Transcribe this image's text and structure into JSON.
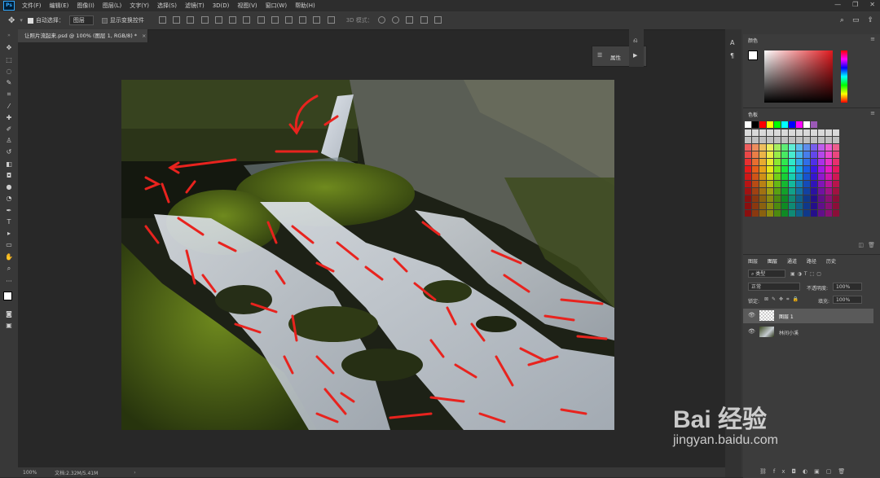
{
  "menu": [
    "文件(F)",
    "编辑(E)",
    "图像(I)",
    "图层(L)",
    "文字(Y)",
    "选择(S)",
    "滤镜(T)",
    "3D(D)",
    "视图(V)",
    "窗口(W)",
    "帮助(H)"
  ],
  "app_logo": "Ps",
  "options": {
    "auto_select_label": "自动选择：",
    "auto_select_value": "图层",
    "show_transform_label": "显示变换控件",
    "mode_3d_label": "3D 模式："
  },
  "document": {
    "tab_title": "让照片流起来.psd @ 100% (图层 1, RGB/8) *",
    "close": "×"
  },
  "status": {
    "zoom": "100%",
    "doc_info": "文档:2.32M/5.41M"
  },
  "properties_label": "属性",
  "panels": {
    "color_tab": "颜色",
    "swatches_tab": "色板",
    "layers_tabs": [
      "图层",
      "通道",
      "路径",
      "历史"
    ],
    "kind_label": "类型",
    "blend_mode": "正常",
    "opacity_label": "不透明度:",
    "opacity_value": "100%",
    "lock_label": "锁定:",
    "fill_label": "填充:",
    "fill_value": "100%",
    "layers": [
      {
        "name": "图层 1"
      },
      {
        "name": "林间小溪"
      }
    ]
  },
  "watermark": {
    "brand": "Bai 经验",
    "url": "jingyan.baidu.com"
  },
  "colors": {
    "accent": "#31a8ff",
    "arrow_red": "#e8231e"
  }
}
